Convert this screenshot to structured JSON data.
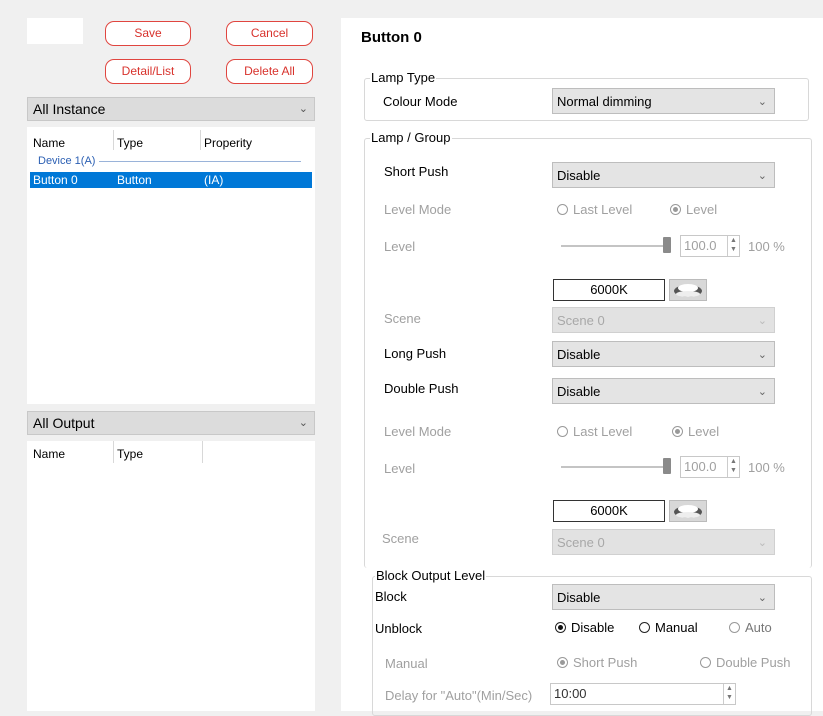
{
  "left": {
    "buttons": {
      "save": "Save",
      "cancel": "Cancel",
      "detail_list": "Detail/List",
      "delete_all": "Delete All"
    },
    "instance_combo": "All Instance",
    "instance_columns": [
      "Name",
      "Type",
      "Properity"
    ],
    "device_group": "Device 1(A)",
    "instance_rows": [
      {
        "name": "Button 0",
        "type": "Button",
        "property": "(IA)",
        "selected": true
      }
    ],
    "output_combo": "All Output",
    "output_columns": [
      "Name",
      "Type"
    ]
  },
  "right": {
    "title": "Button 0",
    "lamp_type": {
      "group_label": "Lamp Type",
      "colour_mode_label": "Colour Mode",
      "colour_mode_value": "Normal dimming"
    },
    "lamp_group": {
      "group_label": "Lamp / Group",
      "short_push_label": "Short Push",
      "short_push_value": "Disable",
      "level_mode_label": "Level Mode",
      "last_level": "Last Level",
      "level_option": "Level",
      "level_label": "Level",
      "level_value": "100.0",
      "level_percent": "100 %",
      "level_fraction": 1.0,
      "cct_value": "6000K",
      "scene_label": "Scene",
      "scene_value": "Scene 0",
      "long_push_label": "Long Push",
      "long_push_value": "Disable",
      "double_push_label": "Double Push",
      "double_push_value": "Disable",
      "level_mode_label2": "Level Mode",
      "last_level2": "Last Level",
      "level_option2": "Level",
      "level_label2": "Level",
      "level_value2": "100.0",
      "level_percent2": "100 %",
      "cct_value2": "6000K",
      "scene_label2": "Scene",
      "scene_value2": "Scene 0"
    },
    "block": {
      "group_label": "Block Output Level",
      "block_label": "Block",
      "block_value": "Disable",
      "unblock_label": "Unblock",
      "unblock_disable": "Disable",
      "unblock_manual": "Manual",
      "unblock_auto": "Auto",
      "manual_label": "Manual",
      "short_push": "Short Push",
      "double_push": "Double Push",
      "delay_label": "Delay for \"Auto\"(Min/Sec)",
      "delay_value": "10:00"
    }
  },
  "colors": {
    "accent_red": "#e0453f",
    "selection_blue": "#0078d7"
  }
}
